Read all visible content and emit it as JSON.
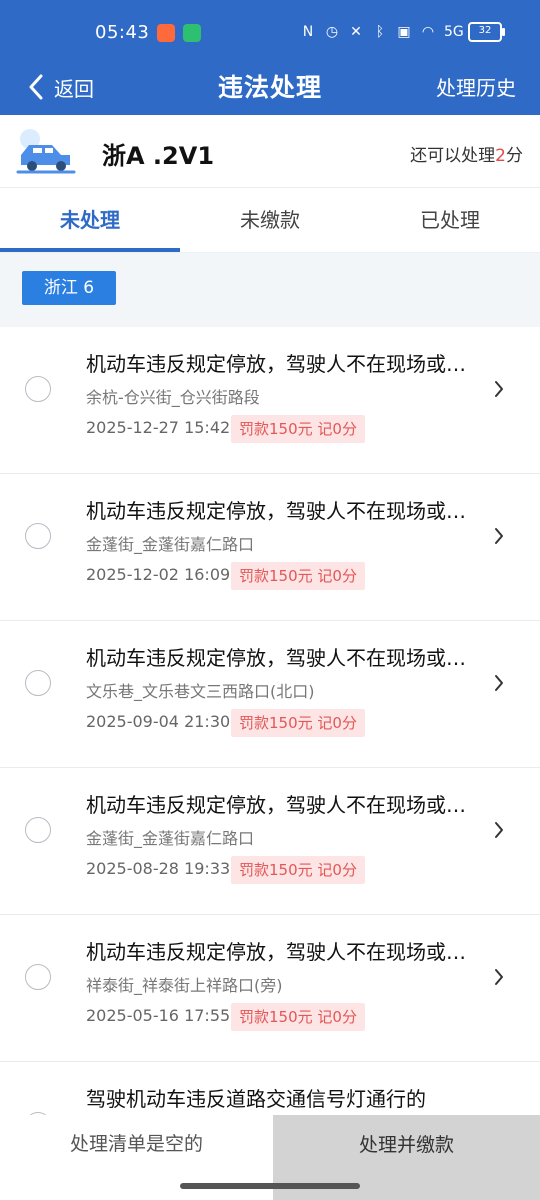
{
  "status_bar": {
    "time": "05:43",
    "battery": "32",
    "network": "5G"
  },
  "nav": {
    "back_label": "返回",
    "title": "违法处理",
    "history_label": "处理历史"
  },
  "vehicle": {
    "plate": "浙A  .2V1",
    "points_prefix": "还可以处理",
    "points_value": "2",
    "points_suffix": "分"
  },
  "tabs": [
    {
      "label": "未处理",
      "active": true
    },
    {
      "label": "未缴款",
      "active": false
    },
    {
      "label": "已处理",
      "active": false
    }
  ],
  "filter": {
    "region": "浙江 6"
  },
  "violations": [
    {
      "title": "机动车违反规定停放，驾驶人不在现场或…",
      "location": "余杭-仓兴街_仓兴街路段",
      "time": "2025-12-27 15:42",
      "fine": "罚款150元 记0分"
    },
    {
      "title": "机动车违反规定停放，驾驶人不在现场或…",
      "location": "金蓬街_金蓬街嘉仁路口",
      "time": "2025-12-02 16:09",
      "fine": "罚款150元 记0分"
    },
    {
      "title": "机动车违反规定停放，驾驶人不在现场或…",
      "location": "文乐巷_文乐巷文三西路口(北口)",
      "time": "2025-09-04 21:30",
      "fine": "罚款150元 记0分"
    },
    {
      "title": "机动车违反规定停放，驾驶人不在现场或…",
      "location": "金蓬街_金蓬街嘉仁路口",
      "time": "2025-08-28 19:33",
      "fine": "罚款150元 记0分"
    },
    {
      "title": "机动车违反规定停放，驾驶人不在现场或…",
      "location": "祥泰街_祥泰街上祥路口(旁)",
      "time": "2025-05-16 17:55",
      "fine": "罚款150元 记0分"
    },
    {
      "title": "驾驶机动车违反道路交通信号灯通行的"
    }
  ],
  "bottom": {
    "empty_note": "处理清单是空的",
    "pay_label": "处理并缴款"
  },
  "colors": {
    "brand": "#2f6bc6",
    "chip": "#2a7fe0",
    "fine_text": "#e35757",
    "fine_bg": "#fde5e5"
  }
}
